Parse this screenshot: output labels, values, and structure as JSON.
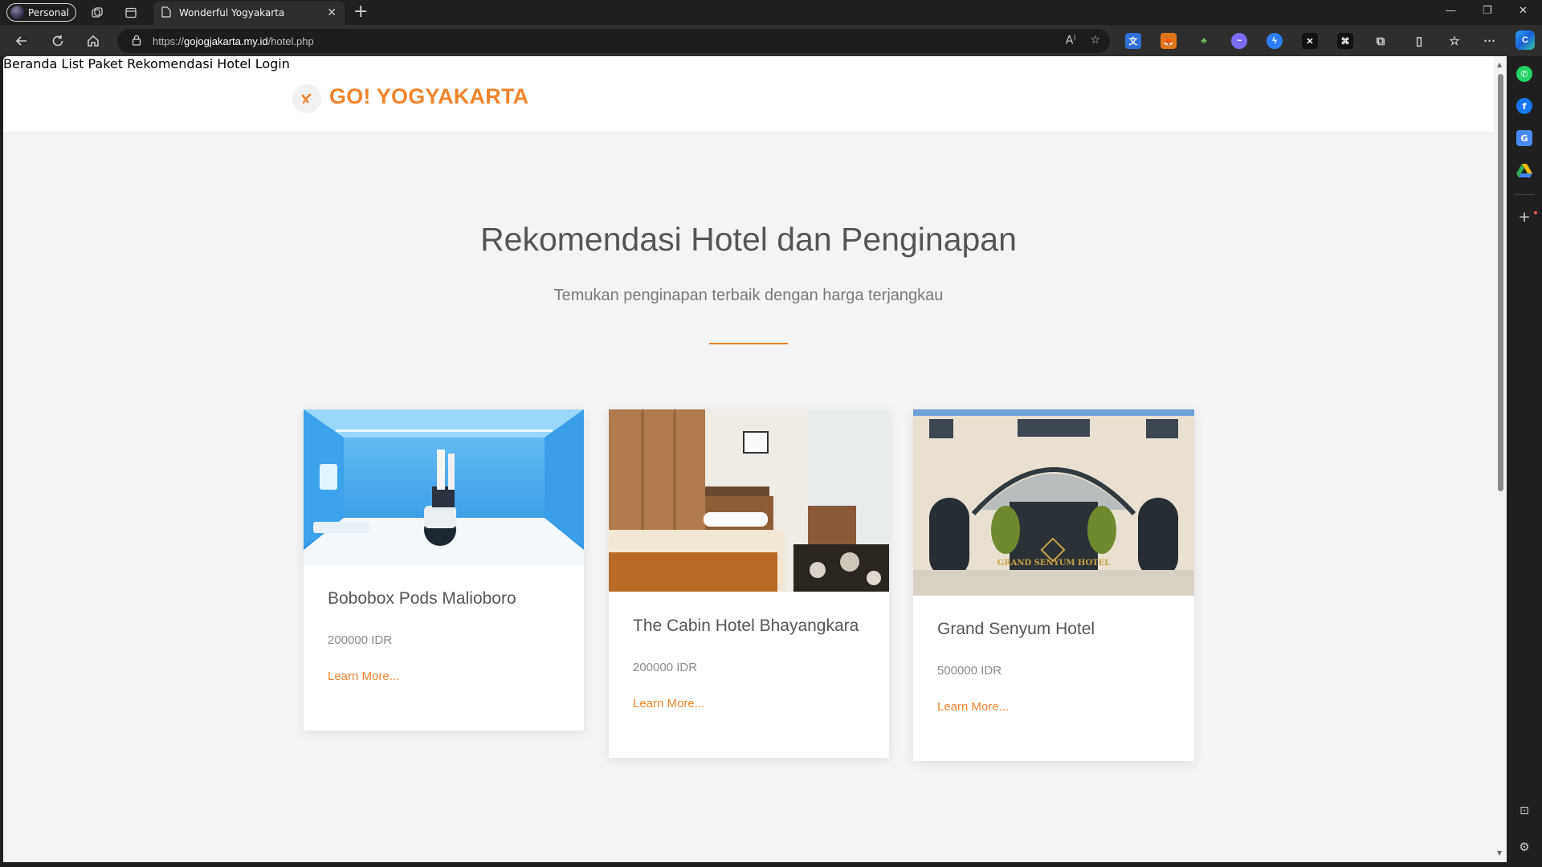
{
  "browser": {
    "profile_label": "Personal",
    "tab_title": "Wonderful Yogyakarta",
    "url_scheme": "https://",
    "url_host": "gojogjakarta.my.id",
    "url_path": "/hotel.php"
  },
  "site": {
    "logo_text": "GO! YOGYAKARTA",
    "accent_color": "#f0842c",
    "nav": [
      "Beranda",
      "List Paket",
      "Rekomendasi Hotel",
      "Login"
    ]
  },
  "hero": {
    "title": "Rekomendasi Hotel dan Penginapan",
    "subtitle": "Temukan penginapan terbaik dengan harga terjangkau"
  },
  "hotels": [
    {
      "name": "Bobobox Pods Malioboro",
      "price": "200000 IDR",
      "link": "Learn More..."
    },
    {
      "name": "The Cabin Hotel Bhayangkara",
      "price": "200000 IDR",
      "link": "Learn More..."
    },
    {
      "name": "Grand Senyum Hotel",
      "price": "500000 IDR",
      "link": "Learn More...",
      "image_sign": "GRAND SENYUM HOTEL"
    }
  ]
}
